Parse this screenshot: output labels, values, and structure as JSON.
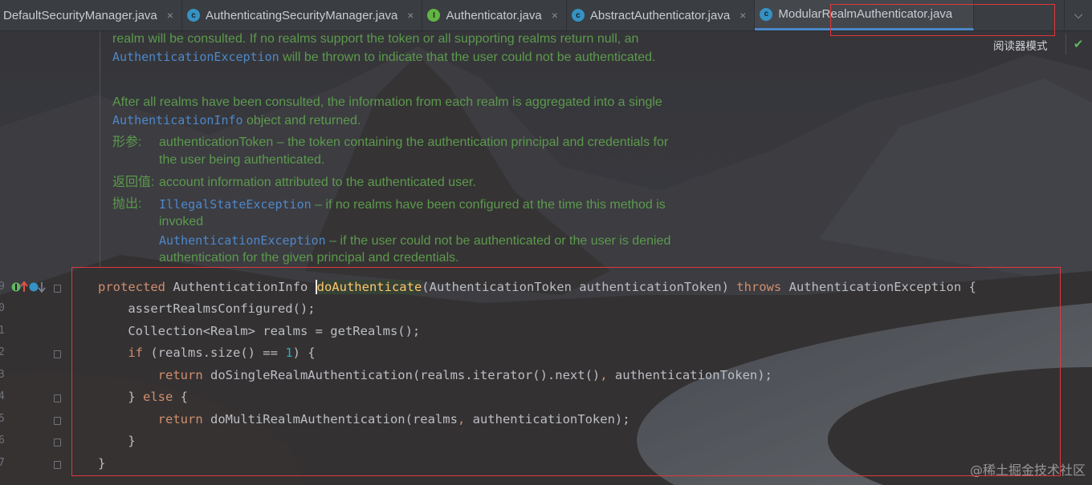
{
  "tabs": [
    {
      "label": "DefaultSecurityManager.java",
      "icon": "class-icon",
      "active": false
    },
    {
      "label": "AuthenticatingSecurityManager.java",
      "icon": "class-icon",
      "active": false
    },
    {
      "label": "Authenticator.java",
      "icon": "interface-icon",
      "active": false
    },
    {
      "label": "AbstractAuthenticator.java",
      "icon": "class-icon",
      "active": false
    },
    {
      "label": "ModularRealmAuthenticator.java",
      "icon": "class-icon",
      "active": true
    }
  ],
  "tab_close_glyph": "×",
  "reader_mode_label": "阅读器模式",
  "doc": {
    "line1": "realm will be consulted. If no realms support the token or all supporting realms return null, an",
    "line2_code": "AuthenticationException",
    "line2_text": " will be thrown to indicate that the user could not be authenticated.",
    "line3": "After all realms have been consulted, the information from each realm is aggregated into a single",
    "line4_code": "AuthenticationInfo",
    "line4_text": " object and returned.",
    "params_label": "形参:",
    "params_line1": "authenticationToken – the token containing the authentication principal and credentials for",
    "params_line2": "the user being authenticated.",
    "returns_label": "返回值:",
    "returns_text": "account information attributed to the authenticated user.",
    "throws_label": "抛出:",
    "throws1_code": "IllegalStateException",
    "throws1_text": " – if no realms have been configured at the time this method is",
    "throws1_line2": "invoked",
    "throws2_code": "AuthenticationException",
    "throws2_text": " – if the user could not be authenticated or the user is denied",
    "throws2_line2": "authentication for the given principal and credentials."
  },
  "gutter_numbers": [
    "9",
    "0",
    "1",
    "2",
    "3",
    "4",
    "5",
    "6",
    "7"
  ],
  "code": {
    "l1_kw": "protected",
    "l1_type": " AuthenticationInfo ",
    "l1_method": "doAuthenticate",
    "l1_params": "(AuthenticationToken authenticationToken) ",
    "l1_throws": "throws",
    "l1_rest": " AuthenticationException {",
    "l2": "    assertRealmsConfigured();",
    "l3": "    Collection<Realm> realms = getRealms();",
    "l4_pre": "    ",
    "l4_kw": "if",
    "l4_mid": " (realms.size() == ",
    "l4_num": "1",
    "l4_post": ") {",
    "l5_pre": "        ",
    "l5_kw": "return",
    "l5_mid": " doSingleRealmAuthentication(realms.iterator().next()",
    "l5_comma": ",",
    "l5_post": " authenticationToken);",
    "l6_pre": "    } ",
    "l6_kw": "else",
    "l6_post": " {",
    "l7_pre": "        ",
    "l7_kw": "return",
    "l7_mid": " doMultiRealmAuthentication(realms",
    "l7_comma": ",",
    "l7_post": " authenticationToken);",
    "l8": "    }",
    "l9": "}"
  },
  "watermark": "@稀土掘金技术社区",
  "colors": {
    "keyword": "#cf8e6d",
    "number": "#2aacb8",
    "doc_text": "#5c9a4c",
    "doc_code": "#4e88c9",
    "highlight_box": "#e0383e"
  }
}
